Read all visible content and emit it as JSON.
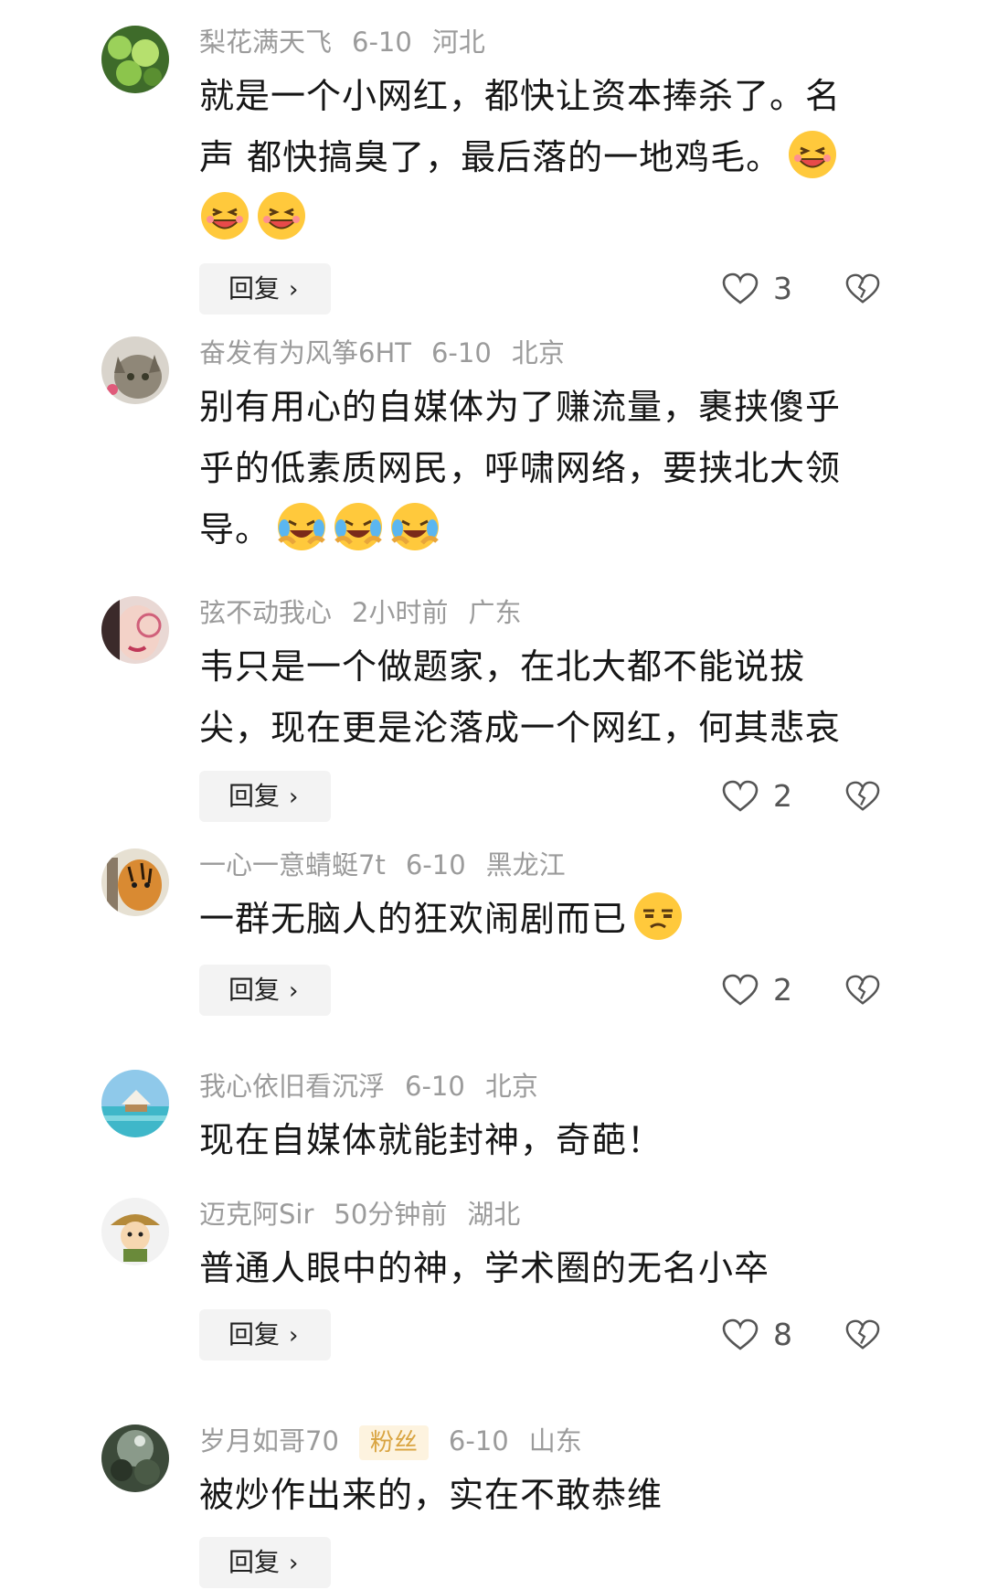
{
  "reply_label": "回复",
  "colors": {
    "meta": "#9b9b9b",
    "text": "#161616",
    "reply_bg": "#f3f3f3",
    "fan_badge_bg": "#fdf3df",
    "fan_badge_text": "#d9a441",
    "emoji_yellow": "#ffc93c"
  },
  "comments": [
    {
      "username": "梨花满天飞",
      "time": "6-10",
      "location": "河北",
      "text": "就是一个小网红，都快让资本捧杀了。名声 都快搞臭了，最后落的一地鸡毛。",
      "emojis": [
        "grin-emoji",
        "grin-emoji",
        "grin-emoji"
      ],
      "likes": "3",
      "has_reply_button": true
    },
    {
      "username": "奋发有为风筝6HT",
      "time": "6-10",
      "location": "北京",
      "text": "别有用心的自媒体为了赚流量，裹挟傻乎乎的低素质网民，呼啸网络，要挟北大领导。",
      "emojis": [
        "laugh-cry-emoji",
        "laugh-cry-emoji",
        "laugh-cry-emoji"
      ],
      "likes": "",
      "has_reply_button": false
    },
    {
      "username": "弦不动我心",
      "time": "2小时前",
      "location": "广东",
      "text": "韦只是一个做题家，在北大都不能说拔尖，现在更是沦落成一个网红，何其悲哀",
      "emojis": [],
      "likes": "2",
      "has_reply_button": true
    },
    {
      "username": "一心一意蜻蜓7t",
      "time": "6-10",
      "location": "黑龙江",
      "text": "一群无脑人的狂欢闹剧而已",
      "emojis": [
        "unamused-emoji"
      ],
      "likes": "2",
      "has_reply_button": true
    },
    {
      "username": "我心依旧看沉浮",
      "time": "6-10",
      "location": "北京",
      "text": "现在自媒体就能封神，奇葩！",
      "emojis": [],
      "likes": "",
      "has_reply_button": false
    },
    {
      "username": "迈克阿Sir",
      "time": "50分钟前",
      "location": "湖北",
      "text": "普通人眼中的神，学术圈的无名小卒",
      "emojis": [],
      "likes": "8",
      "has_reply_button": true
    },
    {
      "username": "岁月如哥70",
      "badge": "粉丝",
      "time": "6-10",
      "location": "山东",
      "text": "被炒作出来的，实在不敢恭维",
      "emojis": [],
      "likes": "",
      "has_reply_button": true
    }
  ]
}
